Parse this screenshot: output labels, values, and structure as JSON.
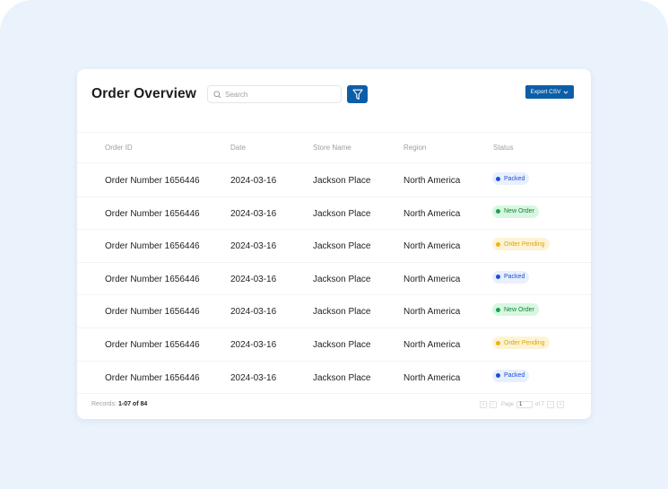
{
  "header": {
    "title": "Order Overview",
    "search_placeholder": "Search",
    "export_label": "Export CSV"
  },
  "table": {
    "columns": [
      "Order ID",
      "Date",
      "Store Name",
      "Region",
      "Status"
    ],
    "rows": [
      {
        "order": "Order Number 1656446",
        "date": "2024-03-16",
        "store": "Jackson Place",
        "region": "North America",
        "status": "Packed"
      },
      {
        "order": "Order Number 1656446",
        "date": "2024-03-16",
        "store": "Jackson Place",
        "region": "North America",
        "status": "New Order"
      },
      {
        "order": "Order Number 1656446",
        "date": "2024-03-16",
        "store": "Jackson Place",
        "region": "North America",
        "status": "Order Pending"
      },
      {
        "order": "Order Number 1656446",
        "date": "2024-03-16",
        "store": "Jackson Place",
        "region": "North America",
        "status": "Packed"
      },
      {
        "order": "Order Number 1656446",
        "date": "2024-03-16",
        "store": "Jackson Place",
        "region": "North America",
        "status": "New Order"
      },
      {
        "order": "Order Number 1656446",
        "date": "2024-03-16",
        "store": "Jackson Place",
        "region": "North America",
        "status": "Order Pending"
      },
      {
        "order": "Order Number 1656446",
        "date": "2024-03-16",
        "store": "Jackson Place",
        "region": "North America",
        "status": "Packed"
      }
    ]
  },
  "status_colors": {
    "Packed": {
      "bg": "#e8f0fd",
      "fg": "#1d4fd6",
      "dot": "#1d4fd6"
    },
    "New Order": {
      "bg": "#d7f7e0",
      "fg": "#17803a",
      "dot": "#17a34a"
    },
    "Order Pending": {
      "bg": "#fdf3d6",
      "fg": "#e0a400",
      "dot": "#f4b400"
    }
  },
  "footer": {
    "records_label": "Records:",
    "records_value": "1-07 of 84",
    "page_label": "Page",
    "page_value": "1",
    "of_label": "of 7"
  },
  "colors": {
    "accent": "#0d5ea8",
    "backdrop": "#eaf2fc"
  },
  "icons": [
    "search-icon",
    "filter-icon",
    "chevron-down-icon",
    "first-page-icon",
    "prev-page-icon",
    "next-page-icon",
    "last-page-icon"
  ]
}
